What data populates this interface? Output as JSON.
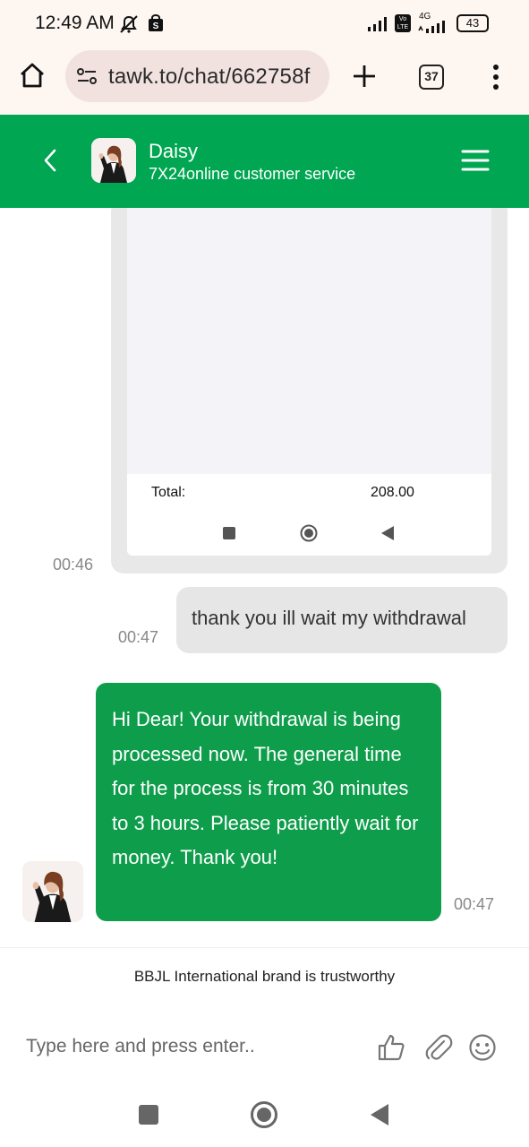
{
  "status_bar": {
    "time": "12:49 AM",
    "network": "4G",
    "battery": "43",
    "volte": "Vo LTE"
  },
  "browser": {
    "url": "tawk.to/chat/662758f",
    "tab_count": "37"
  },
  "chat_header": {
    "agent_name": "Daisy",
    "subtitle": "7X24online customer service"
  },
  "messages": {
    "image_message": {
      "total_label": "Total:",
      "total_value": "208.00",
      "time": "00:46"
    },
    "user_message": {
      "text": "thank you ill wait my withdrawal",
      "time": "00:47"
    },
    "agent_message": {
      "text": "Hi Dear! Your withdrawal is being processed now. The general time for the process is from 30 minutes to 3 hours. Please patiently wait for money. Thank you!",
      "time": "00:47"
    }
  },
  "footer": {
    "brand_note": "BBJL International brand is trustworthy",
    "input_placeholder": "Type here and press enter.."
  },
  "colors": {
    "header_green": "#00a651",
    "agent_bubble_green": "#0e9d4b",
    "user_bubble_gray": "#e6e6e6"
  },
  "icons": [
    "home-icon",
    "site-settings-icon",
    "new-tab-icon",
    "tab-switcher-icon",
    "more-menu-icon",
    "back-icon",
    "hamburger-menu-icon",
    "thumbs-up-icon",
    "attachment-icon",
    "emoji-icon",
    "recent-apps-icon",
    "home-button-icon",
    "back-button-icon"
  ]
}
